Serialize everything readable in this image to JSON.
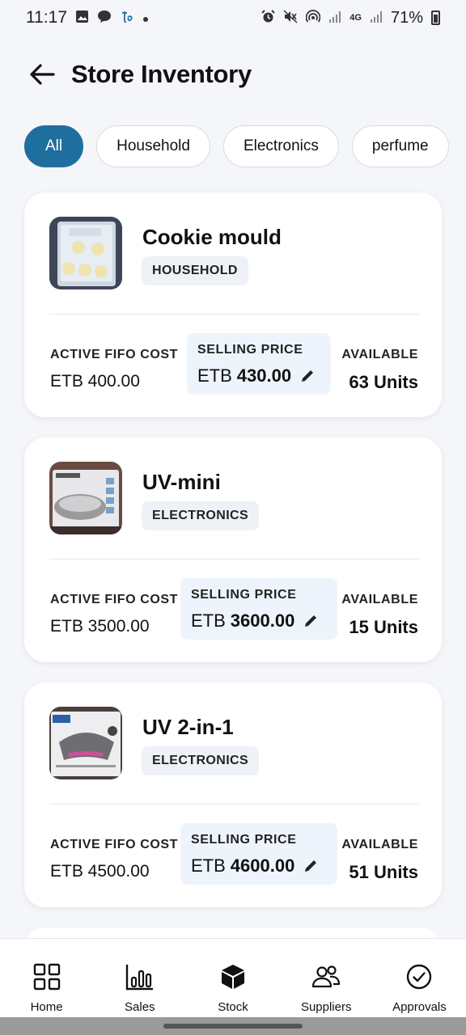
{
  "status_bar": {
    "time": "11:17",
    "battery": "71%",
    "signal_label": "4G"
  },
  "header": {
    "title": "Store Inventory"
  },
  "filters": [
    {
      "label": "All",
      "active": true
    },
    {
      "label": "Household",
      "active": false
    },
    {
      "label": "Electronics",
      "active": false
    },
    {
      "label": "perfume",
      "active": false
    }
  ],
  "products": [
    {
      "name": "Cookie mould",
      "category": "HOUSEHOLD",
      "fifo_label": "ACTIVE FIFO COST",
      "fifo_value": "ETB 400.00",
      "price_label": "SELLING PRICE",
      "price_currency": "ETB",
      "price_value": "430.00",
      "avail_label": "AVAILABLE",
      "avail_value": "63 Units"
    },
    {
      "name": "UV-mini",
      "category": "ELECTRONICS",
      "fifo_label": "ACTIVE FIFO COST",
      "fifo_value": "ETB 3500.00",
      "price_label": "SELLING PRICE",
      "price_currency": "ETB",
      "price_value": "3600.00",
      "avail_label": "AVAILABLE",
      "avail_value": "15 Units"
    },
    {
      "name": "UV 2-in-1",
      "category": "ELECTRONICS",
      "fifo_label": "ACTIVE FIFO COST",
      "fifo_value": "ETB 4500.00",
      "price_label": "SELLING PRICE",
      "price_currency": "ETB",
      "price_value": "4600.00",
      "avail_label": "AVAILABLE",
      "avail_value": "51 Units"
    }
  ],
  "bottom_nav": [
    {
      "label": "Home",
      "icon": "grid-icon"
    },
    {
      "label": "Sales",
      "icon": "bar-chart-icon"
    },
    {
      "label": "Stock",
      "icon": "box-icon"
    },
    {
      "label": "Suppliers",
      "icon": "people-icon"
    },
    {
      "label": "Approvals",
      "icon": "check-circle-icon"
    }
  ],
  "colors": {
    "accent": "#1f6f9e",
    "background": "#f4f6fa",
    "price_box": "#eef4fb",
    "badge": "#eef2f7"
  }
}
